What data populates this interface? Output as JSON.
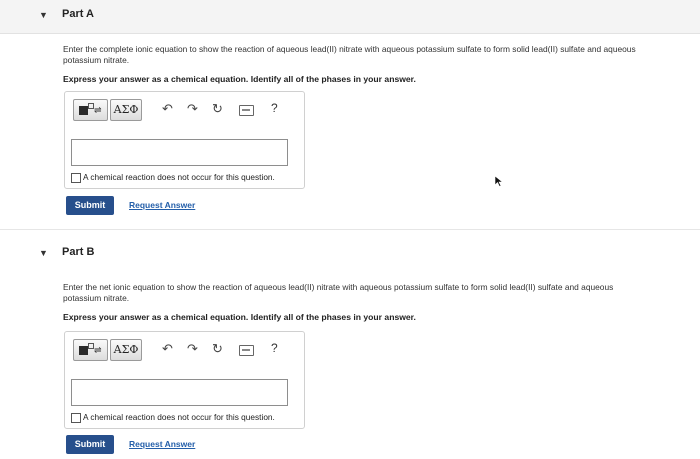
{
  "part_a": {
    "title": "Part A",
    "prompt_line1": "Enter the complete ionic equation to show the reaction of aqueous lead(II) nitrate with aqueous potassium sulfate to form solid lead(II) sulfate and aqueous",
    "prompt_line2": "potassium nitrate.",
    "instruction": "Express your answer as a chemical equation. Identify all of the phases in your answer.",
    "toolbar": {
      "greek_label": "ΑΣΦ",
      "help_label": "?"
    },
    "answer_value": "",
    "no_reaction_label": "A chemical reaction does not occur for this question.",
    "submit_label": "Submit",
    "request_answer_label": "Request Answer"
  },
  "part_b": {
    "title": "Part B",
    "prompt_line1": "Enter the net ionic equation to show the reaction of aqueous lead(II) nitrate with aqueous potassium sulfate to form solid lead(II) sulfate and aqueous",
    "prompt_line2": "potassium nitrate.",
    "instruction": "Express your answer as a chemical equation. Identify all of the phases in your answer.",
    "toolbar": {
      "greek_label": "ΑΣΦ",
      "help_label": "?"
    },
    "answer_value": "",
    "no_reaction_label": "A chemical reaction does not occur for this question.",
    "submit_label": "Submit",
    "request_answer_label": "Request Answer"
  },
  "colors": {
    "submit_bg": "#274f8c",
    "link": "#235ea9"
  }
}
